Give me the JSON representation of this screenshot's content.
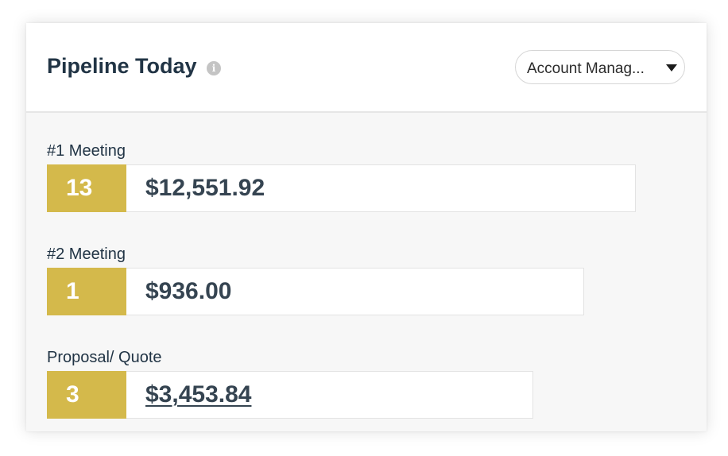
{
  "header": {
    "title": "Pipeline Today",
    "info_icon": "info-icon",
    "filter": {
      "selected": "Account Manag..."
    }
  },
  "stages": [
    {
      "label": "#1 Meeting",
      "count": "13",
      "amount": "$12,551.92"
    },
    {
      "label": "#2 Meeting",
      "count": "1",
      "amount": "$936.00"
    },
    {
      "label": "Proposal/ Quote",
      "count": "3",
      "amount": "$3,453.84"
    }
  ],
  "colors": {
    "accent": "#d4b94b",
    "title": "#213445",
    "amount": "#354451",
    "panel": "#f7f7f7"
  }
}
